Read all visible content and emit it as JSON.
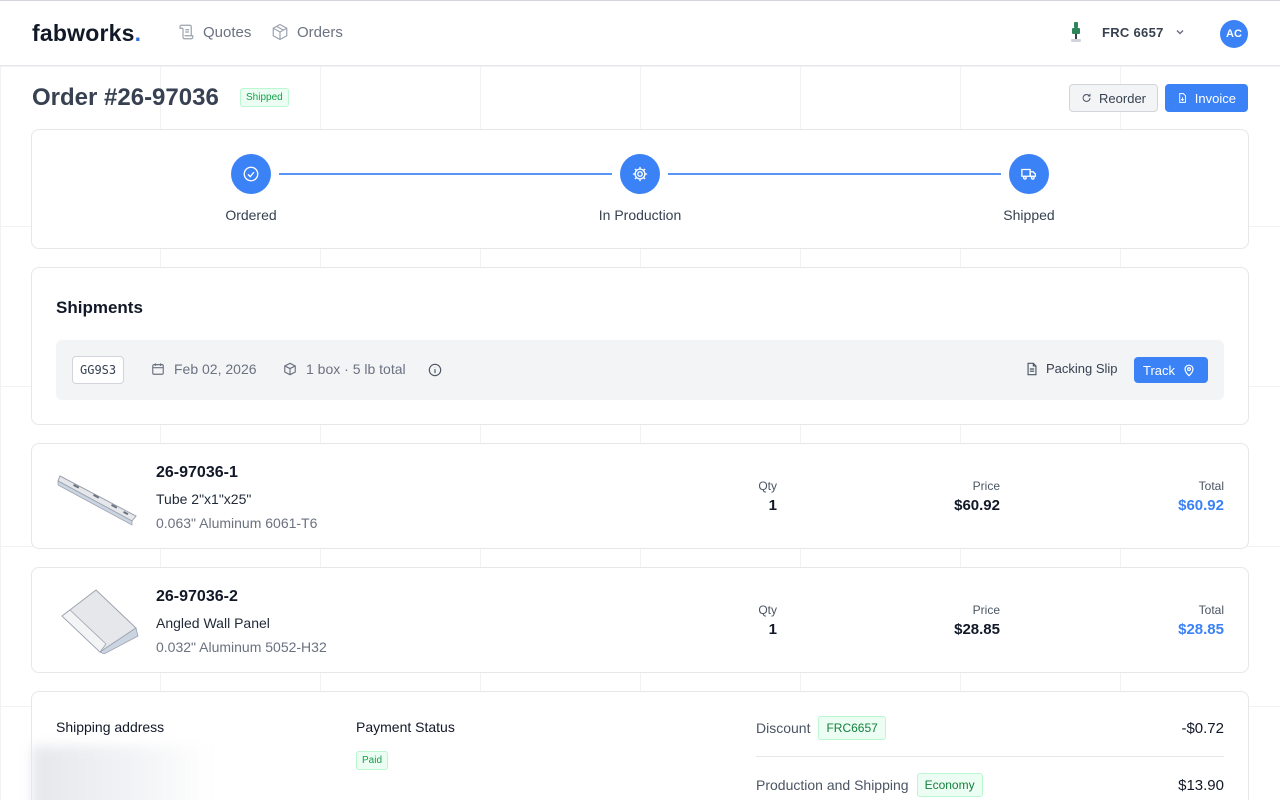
{
  "header": {
    "logo_text": "fabworks",
    "nav": [
      {
        "label": "Quotes",
        "icon": "scroll-icon"
      },
      {
        "label": "Orders",
        "icon": "box-icon"
      }
    ],
    "team_label": "FRC 6657",
    "avatar_initials": "AC"
  },
  "order": {
    "title": "Order #26-97036",
    "status": "Shipped",
    "reorder_label": "Reorder",
    "invoice_label": "Invoice"
  },
  "progress": {
    "steps": [
      {
        "label": "Ordered",
        "icon": "check-circle-icon"
      },
      {
        "label": "In Production",
        "icon": "gear-icon"
      },
      {
        "label": "Shipped",
        "icon": "truck-icon"
      }
    ]
  },
  "shipments": {
    "title": "Shipments",
    "items": [
      {
        "code": "GG9S3",
        "date": "Feb 02, 2026",
        "summary": "1 box · 5 lb total",
        "packing_slip_label": "Packing Slip",
        "track_label": "Track"
      }
    ]
  },
  "items": [
    {
      "part_no": "26-97036-1",
      "name": "Tube 2\"x1\"x25\"",
      "material": "0.063\" Aluminum 6061-T6",
      "qty_label": "Qty",
      "qty": "1",
      "price_label": "Price",
      "price": "$60.92",
      "total_label": "Total",
      "total": "$60.92"
    },
    {
      "part_no": "26-97036-2",
      "name": "Angled Wall Panel",
      "material": "0.032\" Aluminum 5052-H32",
      "qty_label": "Qty",
      "qty": "1",
      "price_label": "Price",
      "price": "$28.85",
      "total_label": "Total",
      "total": "$28.85"
    }
  ],
  "summary": {
    "shipping_address_label": "Shipping address",
    "payment_status_label": "Payment Status",
    "payment_status": "Paid",
    "lines": [
      {
        "label": "Discount",
        "tag": "FRC6657",
        "amount": "-$0.72"
      },
      {
        "label": "Production and Shipping",
        "tag": "Economy",
        "amount": "$13.90"
      }
    ]
  },
  "colors": {
    "accent": "#3b82f6",
    "success": "#16a34a",
    "logo_dot": "#2f6fe4"
  }
}
